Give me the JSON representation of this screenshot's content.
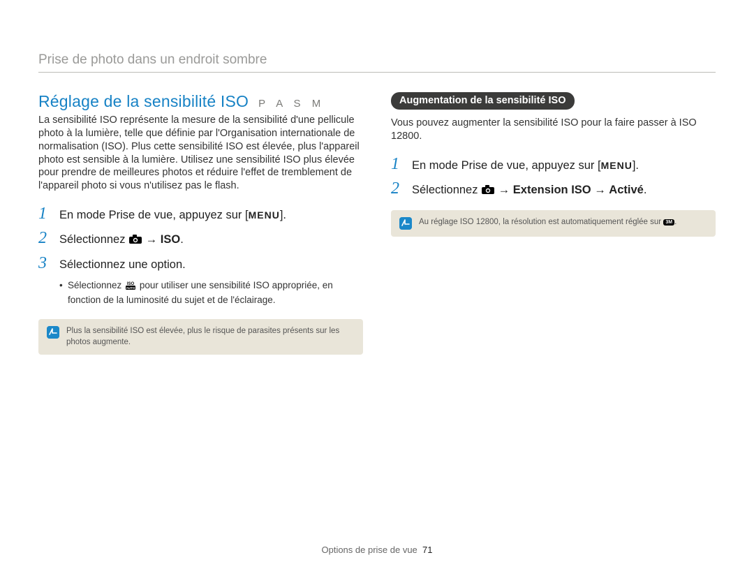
{
  "header": {
    "topic": "Prise de photo dans un endroit sombre"
  },
  "left": {
    "title": "Réglage de la sensibilité ISO",
    "modes": "P A S M",
    "intro": "La sensibilité ISO représente la mesure de la sensibilité d'une pellicule photo à la lumière, telle que définie par l'Organisation internationale de normalisation (ISO). Plus cette sensibilité ISO est élevée, plus l'appareil photo est sensible à la lumière. Utilisez une sensibilité ISO plus élevée pour prendre de meilleures photos et réduire l'effet de tremblement de l'appareil photo si vous n'utilisez pas le flash.",
    "steps": [
      {
        "num": "1",
        "pre": "En mode Prise de vue, appuyez sur [",
        "post": "]."
      },
      {
        "num": "2",
        "pre": "Sélectionnez ",
        "arrow": " → ",
        "target": "ISO",
        "post": "."
      },
      {
        "num": "3",
        "pre": "Sélectionnez une option."
      }
    ],
    "sub": {
      "pre": "Sélectionnez ",
      "post": " pour utiliser une sensibilité ISO appropriée, en fonction de la luminosité du sujet et de l'éclairage."
    },
    "note": "Plus la sensibilité ISO est élevée, plus le risque de parasites présents sur les photos augmente."
  },
  "right": {
    "pill": "Augmentation de la sensibilité ISO",
    "intro": "Vous pouvez augmenter la sensibilité ISO pour la faire passer à ISO 12800.",
    "steps": [
      {
        "num": "1",
        "pre": "En mode Prise de vue, appuyez sur [",
        "post": "]."
      },
      {
        "num": "2",
        "pre": "Sélectionnez ",
        "arrow1": " → ",
        "bold1": "Extension ISO",
        "arrow2": " → ",
        "bold2": "Activé",
        "post": "."
      }
    ],
    "note_pre": "Au réglage ISO 12800, la résolution est automatiquement réglée sur ",
    "note_post": "."
  },
  "footer": {
    "label": "Options de prise de vue",
    "page": "71"
  },
  "glyphs": {
    "menu": "MENU"
  }
}
